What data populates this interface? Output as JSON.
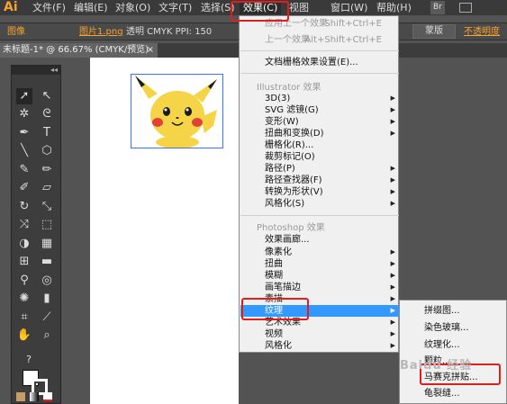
{
  "app": {
    "logo": "Ai"
  },
  "menubar": {
    "items": [
      {
        "label": "文件(F)"
      },
      {
        "label": "编辑(E)"
      },
      {
        "label": "对象(O)"
      },
      {
        "label": "文字(T)"
      },
      {
        "label": "选择(S)"
      },
      {
        "label": "效果(C)"
      },
      {
        "label": "视图"
      },
      {
        "label": "窗口(W)"
      },
      {
        "label": "帮助(H)"
      }
    ],
    "right_badge": "Br"
  },
  "controlbar": {
    "label_image": "图像",
    "image_link": "图片1.png",
    "info": "透明  CMYK  PPI: 150",
    "right_button": "蒙版",
    "opacity_label": "不透明度"
  },
  "doc_tab": {
    "title": "未标题-1* @ 66.67% (CMYK/预览)",
    "close": "×"
  },
  "toolpanel": {
    "collapse": "◂◂"
  },
  "effects_menu": {
    "apply_last": {
      "label": "应用上一个效果",
      "shortcut": "Shift+Ctrl+E"
    },
    "last_effect": {
      "label": "上一个效果",
      "shortcut": "Alt+Shift+Ctrl+E"
    },
    "raster_settings": "文档栅格效果设置(E)...",
    "illustrator_header": "Illustrator 效果",
    "illustrator_items": [
      {
        "label": "3D(3)",
        "sub": true
      },
      {
        "label": "SVG 滤镜(G)",
        "sub": true
      },
      {
        "label": "变形(W)",
        "sub": true
      },
      {
        "label": "扭曲和变换(D)",
        "sub": true
      },
      {
        "label": "栅格化(R)...",
        "sub": false
      },
      {
        "label": "裁剪标记(O)",
        "sub": false
      },
      {
        "label": "路径(P)",
        "sub": true
      },
      {
        "label": "路径查找器(F)",
        "sub": true
      },
      {
        "label": "转换为形状(V)",
        "sub": true
      },
      {
        "label": "风格化(S)",
        "sub": true
      }
    ],
    "photoshop_header": "Photoshop 效果",
    "photoshop_items": [
      {
        "label": "效果画廊...",
        "sub": false
      },
      {
        "label": "像素化",
        "sub": true
      },
      {
        "label": "扭曲",
        "sub": true
      },
      {
        "label": "模糊",
        "sub": true
      },
      {
        "label": "画笔描边",
        "sub": true
      },
      {
        "label": "素描",
        "sub": true
      },
      {
        "label": "纹理",
        "sub": true
      },
      {
        "label": "艺术效果",
        "sub": true
      },
      {
        "label": "视频",
        "sub": true
      },
      {
        "label": "风格化",
        "sub": true
      }
    ],
    "highlighted": "纹理"
  },
  "texture_submenu": {
    "items": [
      {
        "label": "拼缀图..."
      },
      {
        "label": "染色玻璃..."
      },
      {
        "label": "纹理化..."
      },
      {
        "label": "颗粒..."
      },
      {
        "label": "马赛克拼贴..."
      },
      {
        "label": "龟裂缝..."
      }
    ]
  },
  "watermark": "Baidu 经验",
  "colors": {
    "highlight": "#3399ff",
    "annotation": "#e01e1e",
    "accent": "#f7a32d"
  }
}
